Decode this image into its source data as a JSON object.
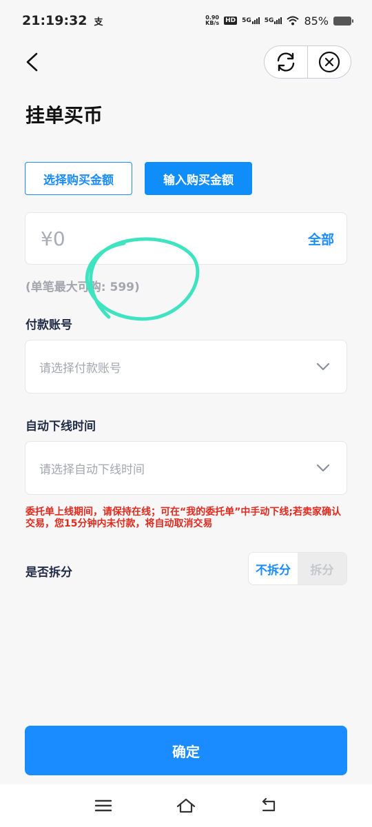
{
  "status_bar": {
    "time": "21:19:32",
    "pay_glyph": "支",
    "net_speed_value": "0.90",
    "net_speed_unit": "KB/s",
    "hd_label": "HD",
    "signal1": "5G",
    "signal2": "5G",
    "battery": "85%"
  },
  "header": {
    "title": "挂单买币",
    "back_icon": "chevron-left-icon",
    "refresh_icon": "refresh-icon",
    "close_icon": "close-circle-icon"
  },
  "mode_tabs": {
    "select_label": "选择购买金额",
    "input_label": "输入购买金额",
    "active": "input"
  },
  "amount": {
    "value": "¥0",
    "all_label": "全部",
    "max_hint": "(单笔最大可购: 599)"
  },
  "payment_account": {
    "label": "付款账号",
    "placeholder": "请选择付款账号"
  },
  "auto_offline": {
    "label": "自动下线时间",
    "placeholder": "请选择自动下线时间"
  },
  "warning": {
    "text": "委托单上线期间，请保持在线；可在“我的委托单”中手动下线;若卖家确认交易，您15分钟内未付款，将自动取消交易"
  },
  "split": {
    "label": "是否拆分",
    "options": [
      "不拆分",
      "拆分"
    ],
    "selected": "不拆分"
  },
  "confirm": {
    "label": "确定"
  },
  "colors": {
    "accent": "#1a8cff",
    "warning": "#e02a1e",
    "scribble": "#3fe3c0"
  }
}
